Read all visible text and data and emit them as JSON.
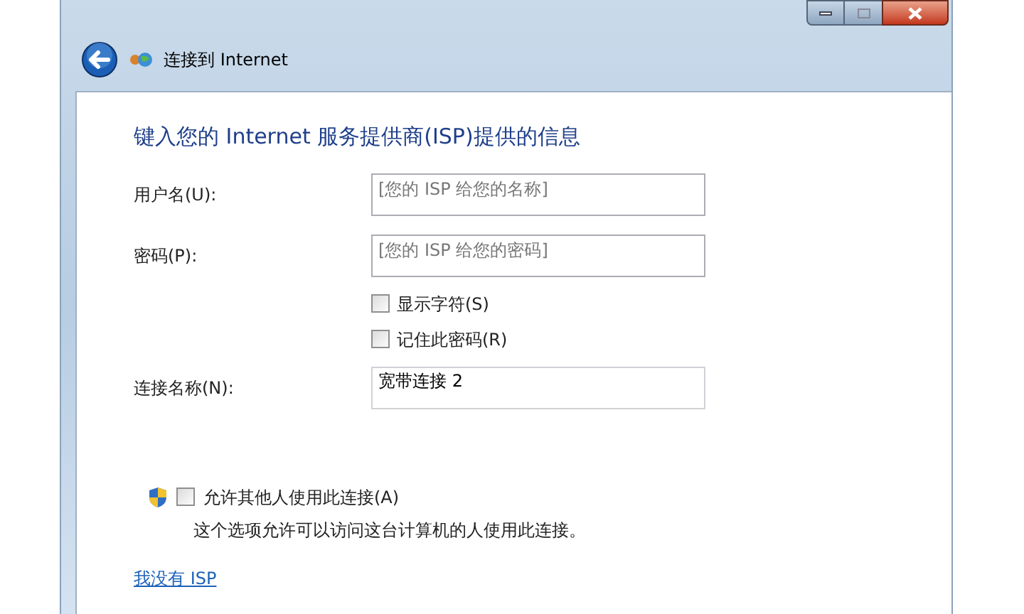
{
  "window": {
    "title": "连接到 Internet"
  },
  "heading": "键入您的 Internet 服务提供商(ISP)提供的信息",
  "fields": [
    {
      "label": "用户名(U):",
      "placeholder": "[您的 ISP 给您的名称]"
    },
    {
      "label": "密码(P):",
      "placeholder": "[您的 ISP 给您的密码]"
    }
  ],
  "options": [
    {
      "label": "显示字符(S)",
      "checked": false
    },
    {
      "label": "记住此密码(R)",
      "checked": false
    }
  ],
  "connection_name": {
    "label": "连接名称(N):",
    "value": "宽带连接 2"
  },
  "share": {
    "label": "允许其他人使用此连接(A)",
    "checked": false,
    "description": "这个选项允许可以访问这台计算机的人使用此连接。"
  },
  "link": "我没有 ISP"
}
